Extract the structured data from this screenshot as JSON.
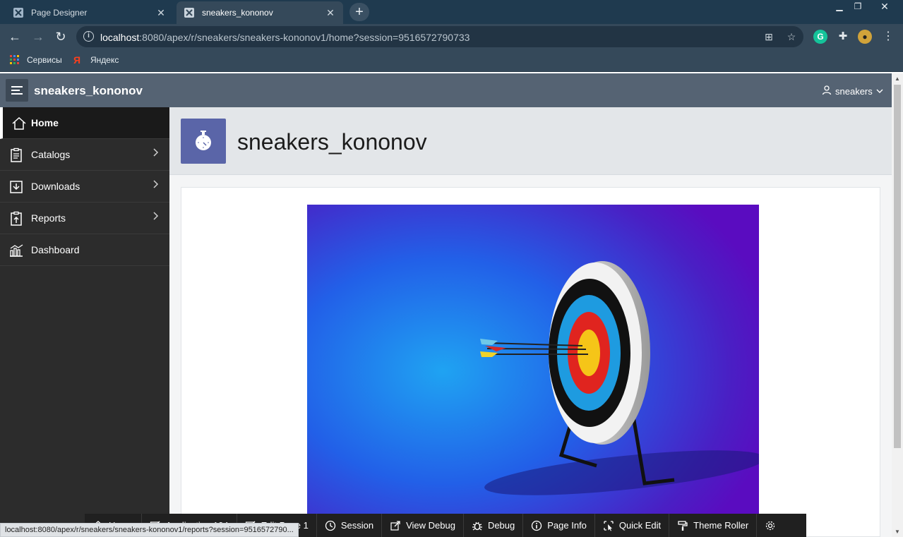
{
  "browser": {
    "tabs": [
      {
        "label": "Page Designer",
        "active": false
      },
      {
        "label": "sneakers_kononov",
        "active": true
      }
    ],
    "new_tab_label": "+",
    "url_host": "localhost",
    "url_rest": ":8080/apex/r/sneakers/sneakers-kononov1/home?session=9516572790733",
    "bookmarks": [
      "Сервисы",
      "Яндекс"
    ],
    "status_url": "localhost:8080/apex/r/sneakers/sneakers-kononov1/reports?session=9516572790..."
  },
  "app": {
    "title": "sneakers_kononov",
    "user": "sneakers",
    "page_title": "sneakers_kononov"
  },
  "nav": [
    {
      "label": "Home",
      "selected": true,
      "icon": "home-icon",
      "has_children": false
    },
    {
      "label": "Catalogs",
      "selected": false,
      "icon": "clipboard-icon",
      "has_children": true
    },
    {
      "label": "Downloads",
      "selected": false,
      "icon": "download-icon",
      "has_children": true
    },
    {
      "label": "Reports",
      "selected": false,
      "icon": "clipboard-upload-icon",
      "has_children": true
    },
    {
      "label": "Dashboard",
      "selected": false,
      "icon": "bar-chart-icon",
      "has_children": false
    }
  ],
  "devbar": {
    "items": [
      {
        "label": "Home",
        "icon": "home-icon"
      },
      {
        "label": "Application 104",
        "icon": "edit-icon"
      },
      {
        "label": "Edit Page 1",
        "icon": "edit-icon"
      },
      {
        "label": "Session",
        "icon": "session-icon"
      },
      {
        "label": "View Debug",
        "icon": "external-link-icon"
      },
      {
        "label": "Debug",
        "icon": "bug-icon"
      },
      {
        "label": "Page Info",
        "icon": "info-icon"
      },
      {
        "label": "Quick Edit",
        "icon": "quick-edit-icon"
      },
      {
        "label": "Theme Roller",
        "icon": "paint-roller-icon"
      },
      {
        "label": "",
        "icon": "gear-icon"
      }
    ]
  },
  "colors": {
    "header": "#556373",
    "sidebar": "#2c2c2c",
    "hero_icon": "#5a65a8",
    "image_bg": "#2f3fd6"
  }
}
